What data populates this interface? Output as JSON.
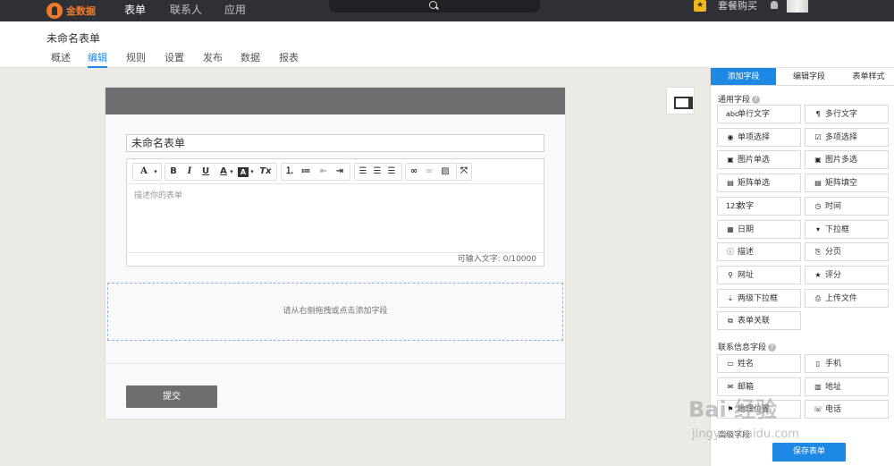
{
  "topnav": {
    "logo_text": "金数据",
    "items": [
      {
        "label": "表单",
        "active": true
      },
      {
        "label": "联系人",
        "active": false
      },
      {
        "label": "应用",
        "active": false
      }
    ],
    "search_icon": "search-icon",
    "package_label": "套餐购买",
    "package_icon": "gift-icon",
    "bell_icon": "bell-icon"
  },
  "subheader": {
    "form_title": "未命名表单",
    "tabs": [
      {
        "label": "概述",
        "active": false
      },
      {
        "label": "编辑",
        "active": true
      },
      {
        "label": "规则",
        "active": false
      },
      {
        "label": "设置",
        "active": false
      },
      {
        "label": "发布",
        "active": false
      },
      {
        "label": "数据",
        "active": false
      },
      {
        "label": "报表",
        "active": false
      }
    ]
  },
  "form": {
    "title_value": "未命名表单",
    "toolbar": {
      "font": "A",
      "bold": "B",
      "italic": "I",
      "underline": "U",
      "font_color": "A",
      "bg_color": "A",
      "clear_format": "Tx"
    },
    "description_placeholder": "描述你的表单",
    "counter": "可输入文字: 0/10000",
    "dropzone_hint": "请从右侧拖拽或点击添加字段",
    "submit_label": "提交"
  },
  "rpanel": {
    "tabs": [
      {
        "label": "添加字段",
        "active": true
      },
      {
        "label": "编辑字段",
        "active": false
      },
      {
        "label": "表单样式",
        "active": false
      }
    ],
    "general_title": "通用字段",
    "general_fields": [
      {
        "label": "单行文字",
        "icon": "abc"
      },
      {
        "label": "多行文字",
        "icon": "¶"
      },
      {
        "label": "单项选择",
        "icon": "◉"
      },
      {
        "label": "多项选择",
        "icon": "☑"
      },
      {
        "label": "图片单选",
        "icon": "▣"
      },
      {
        "label": "图片多选",
        "icon": "▣"
      },
      {
        "label": "矩阵单选",
        "icon": "▤"
      },
      {
        "label": "矩阵填空",
        "icon": "▤"
      },
      {
        "label": "数字",
        "icon": "123"
      },
      {
        "label": "时间",
        "icon": "◷"
      },
      {
        "label": "日期",
        "icon": "▦"
      },
      {
        "label": "下拉框",
        "icon": "▾"
      },
      {
        "label": "描述",
        "icon": "ⓘ"
      },
      {
        "label": "分页",
        "icon": "⎘"
      },
      {
        "label": "网址",
        "icon": "⚲"
      },
      {
        "label": "评分",
        "icon": "★"
      },
      {
        "label": "两级下拉框",
        "icon": "⇣"
      },
      {
        "label": "上传文件",
        "icon": "⎙"
      },
      {
        "label": "表单关联",
        "icon": "⧉"
      }
    ],
    "contact_title": "联系信息字段",
    "contact_fields": [
      {
        "label": "姓名",
        "icon": "▭"
      },
      {
        "label": "手机",
        "icon": "▯"
      },
      {
        "label": "邮箱",
        "icon": "✉"
      },
      {
        "label": "地址",
        "icon": "▥"
      },
      {
        "label": "地理位置",
        "icon": "⚑"
      },
      {
        "label": "电话",
        "icon": "☏"
      }
    ],
    "cut_section_title": "高级字段",
    "save_label": "保存表单"
  },
  "watermark": {
    "text": "Bai 经验",
    "sub": "jingyan.baidu.com"
  }
}
